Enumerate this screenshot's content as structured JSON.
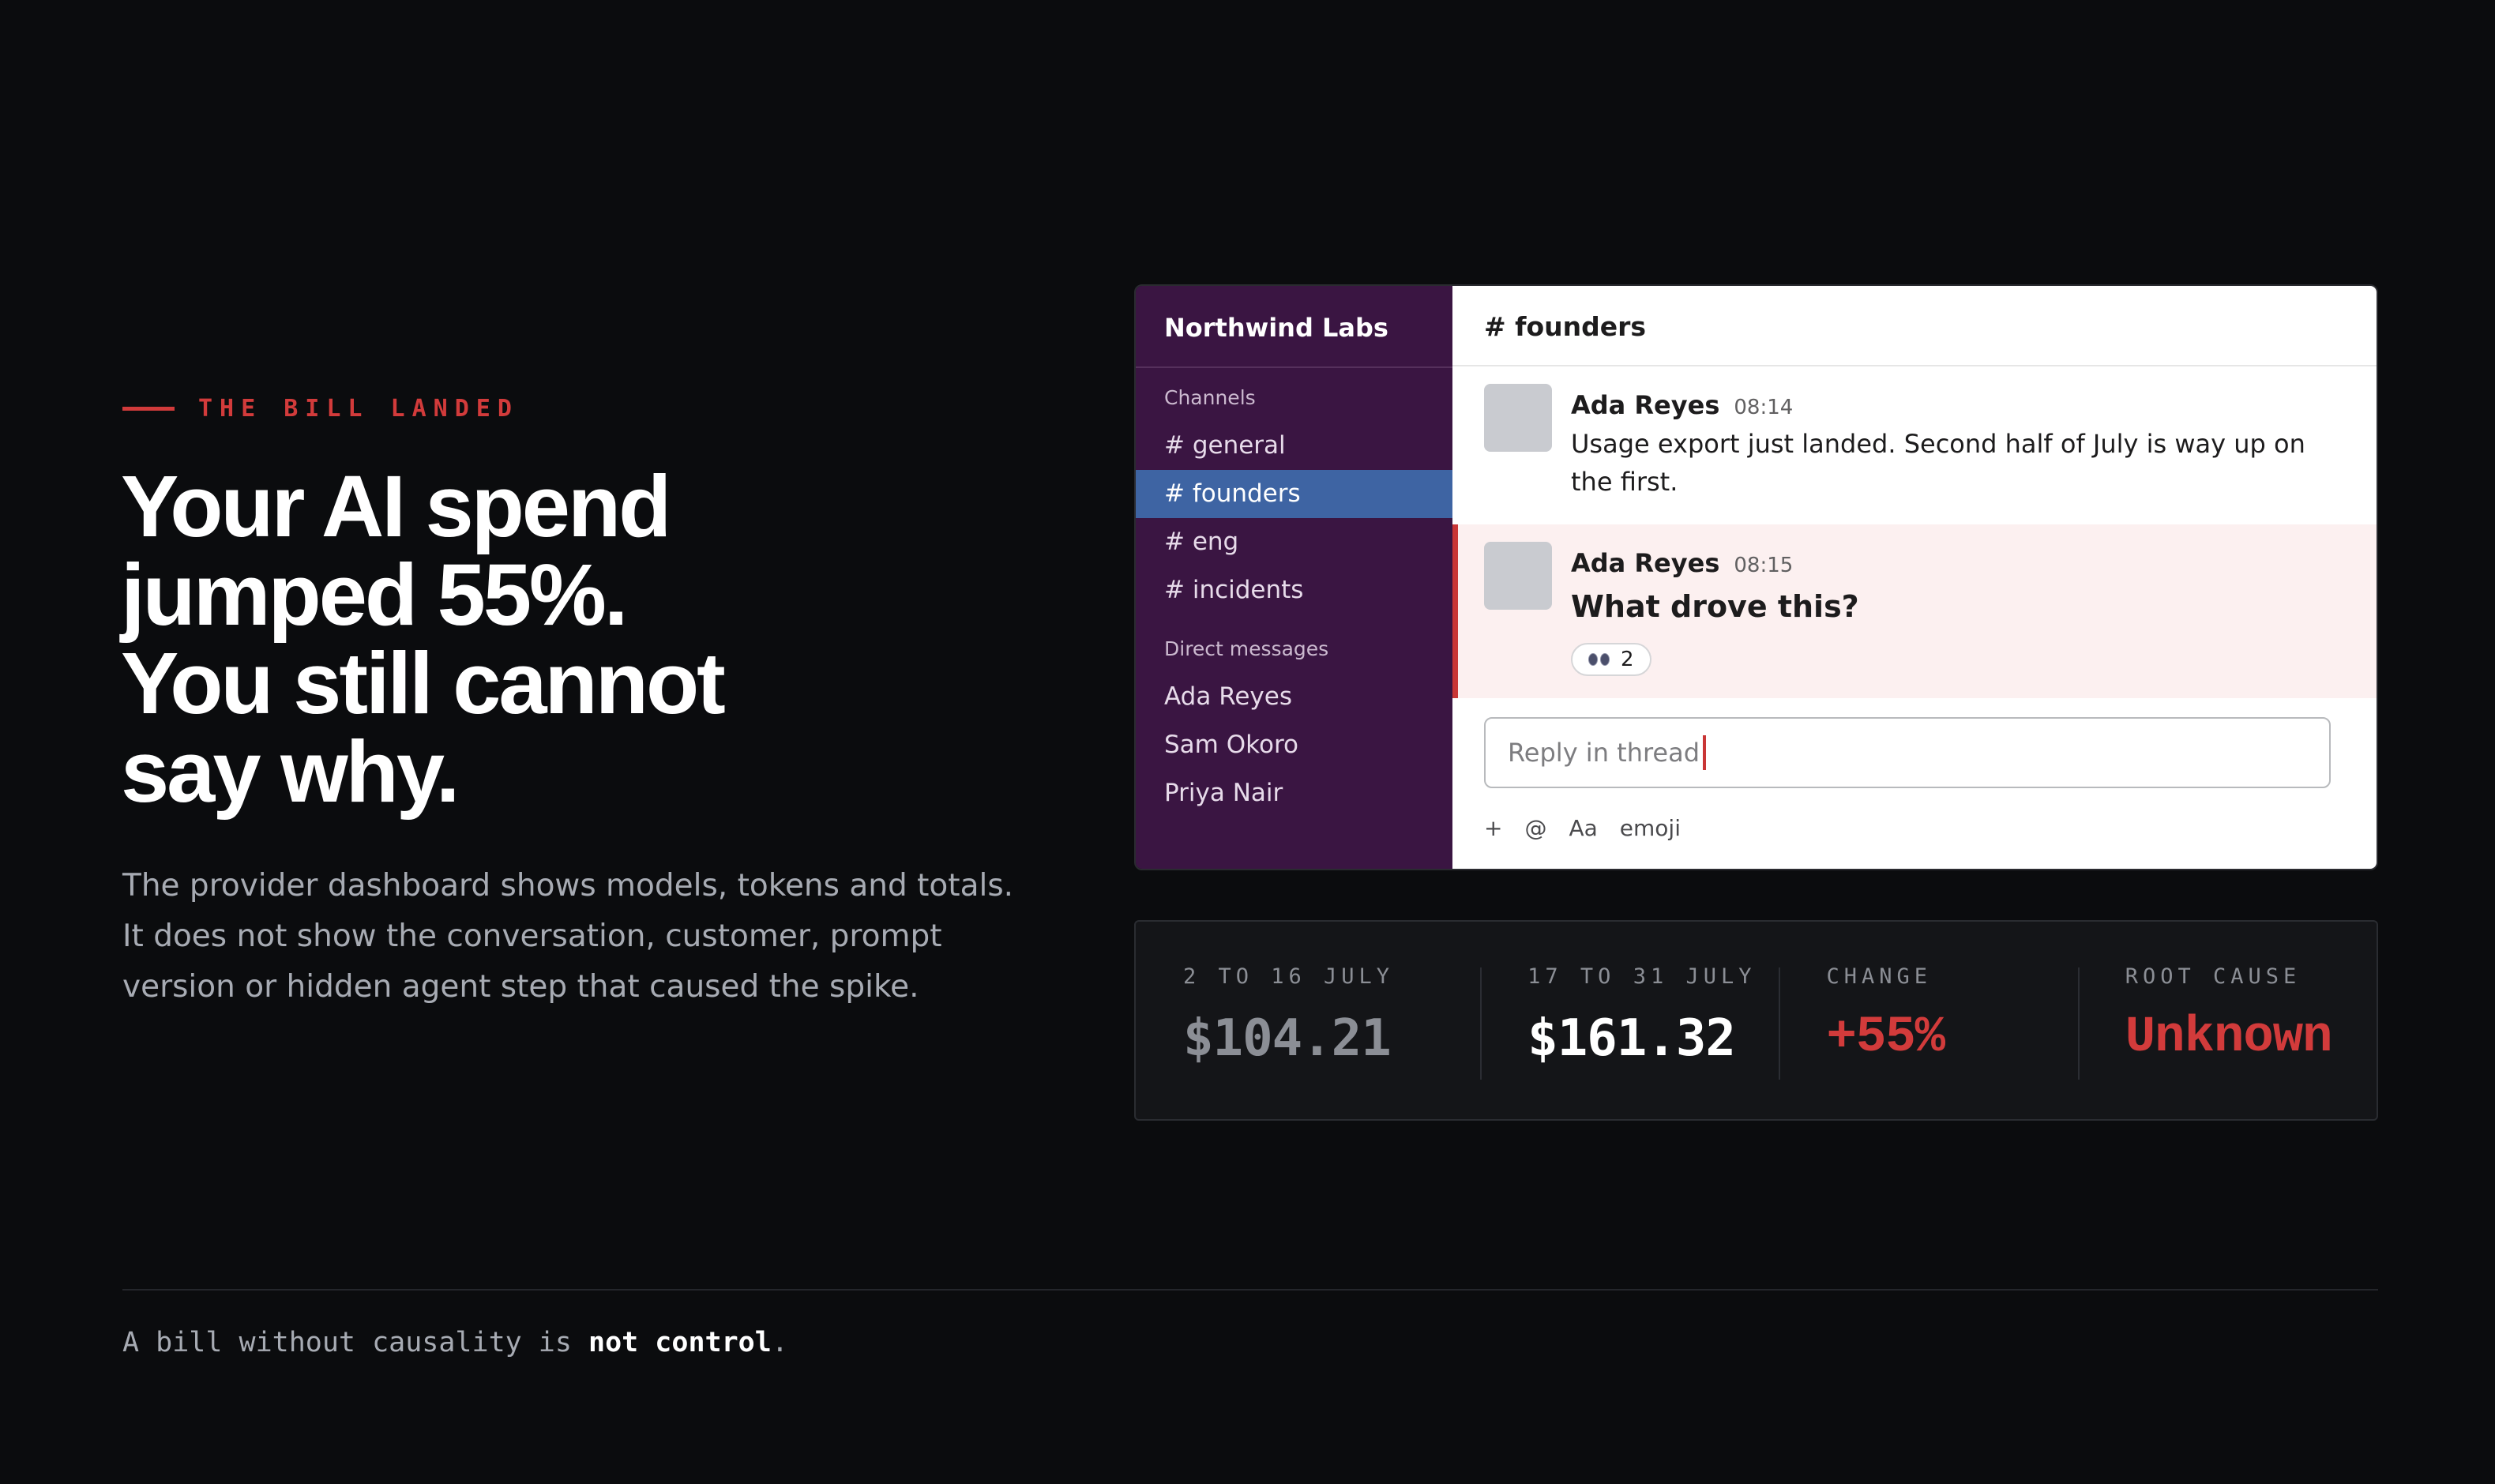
{
  "hero": {
    "eyebrow": "THE BILL LANDED",
    "headline": [
      "Your AI spend",
      "jumped 55%.",
      "You still cannot",
      "say why."
    ],
    "lede": "The provider dashboard shows models, tokens and totals. It does not show the conversation, customer, prompt version or hidden agent step that caused the spike."
  },
  "chat": {
    "workspace": "Northwind Labs",
    "channels_heading": "Channels",
    "channels": [
      "# general",
      "# founders",
      "# eng",
      "# incidents"
    ],
    "active_channel": "# founders",
    "dm_heading": "Direct messages",
    "dms": [
      "Ada Reyes",
      "Sam Okoro",
      "Priya Nair"
    ],
    "channel_title": "# founders",
    "messages": [
      {
        "author": "Ada Reyes",
        "time": "08:14",
        "text": "Usage export just landed. Second half of July is way up on the first."
      },
      {
        "author": "Ada Reyes",
        "time": "08:15",
        "text": "What drove this?",
        "reaction": {
          "icon": "eyes-icon",
          "count": "2"
        }
      }
    ],
    "composer_placeholder": "Reply in thread",
    "tools": [
      "+",
      "@",
      "Aa",
      "emoji"
    ]
  },
  "stats": [
    {
      "label": "2 TO 16 JULY",
      "value": "$104.21"
    },
    {
      "label": "17 TO 31 JULY",
      "value": "$161.32"
    },
    {
      "label": "CHANGE",
      "value": "+55%"
    },
    {
      "label": "ROOT CAUSE",
      "value": "Unknown"
    }
  ],
  "footer": {
    "tagline_start": "A bill without causality is ",
    "tagline_bold": "not control",
    "tagline_end": "."
  },
  "colors": {
    "accent_red": "#d23b3b",
    "sidebar": "#3a1542",
    "active_channel": "#3e64a3",
    "background": "#0b0c0e"
  }
}
